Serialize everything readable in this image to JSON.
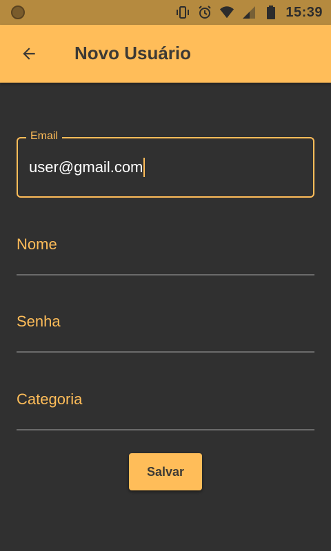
{
  "status_bar": {
    "time": "15:39",
    "icons": [
      "vibrate-icon",
      "alarm-icon",
      "wifi-icon",
      "signal-icon",
      "battery-icon"
    ]
  },
  "app_bar": {
    "back_icon": "arrow-back-icon",
    "title": "Novo Usuário"
  },
  "form": {
    "email": {
      "label": "Email",
      "value": "user@gmail.com"
    },
    "nome": {
      "label": "Nome",
      "value": ""
    },
    "senha": {
      "label": "Senha",
      "value": ""
    },
    "categoria": {
      "label": "Categoria",
      "value": ""
    },
    "save_label": "Salvar"
  },
  "colors": {
    "accent": "#ffbd59",
    "background": "#303030",
    "status_bar": "#b58a3f",
    "divider": "#6b6b6b"
  }
}
